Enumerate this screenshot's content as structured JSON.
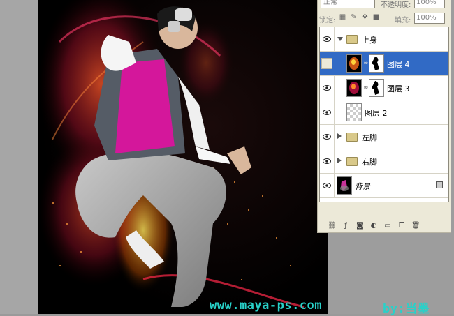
{
  "layers_panel": {
    "blend_mode": "正常",
    "opacity_label": "不透明度:",
    "opacity_value": "100%",
    "lock_label": "锁定:",
    "fill_label": "填充:",
    "fill_value": "100%",
    "layers": [
      {
        "name": "上身",
        "kind": "group",
        "expanded": true,
        "visible": true,
        "selected": false
      },
      {
        "name": "图层 4",
        "kind": "layer-mask",
        "visible": false,
        "selected": true
      },
      {
        "name": "图层 3",
        "kind": "layer-mask",
        "visible": true,
        "selected": false
      },
      {
        "name": "图层 2",
        "kind": "layer",
        "visible": true,
        "selected": false
      },
      {
        "name": "左脚",
        "kind": "group",
        "expanded": false,
        "visible": true,
        "selected": false
      },
      {
        "name": "右脚",
        "kind": "group",
        "expanded": false,
        "visible": true,
        "selected": false
      },
      {
        "name": "背景",
        "kind": "background",
        "visible": true,
        "selected": false,
        "locked": true
      }
    ],
    "bottom_icons": [
      "link-icon",
      "fx-icon",
      "mask-icon",
      "adjustment-icon",
      "folder-icon",
      "new-layer-icon",
      "trash-icon"
    ]
  },
  "watermark": {
    "site": "www.maya-ps.com",
    "author": "by:当墨"
  },
  "colors": {
    "selection": "#316ac5",
    "panel_bg": "#ece9d8",
    "watermark": "#28d1c9"
  }
}
